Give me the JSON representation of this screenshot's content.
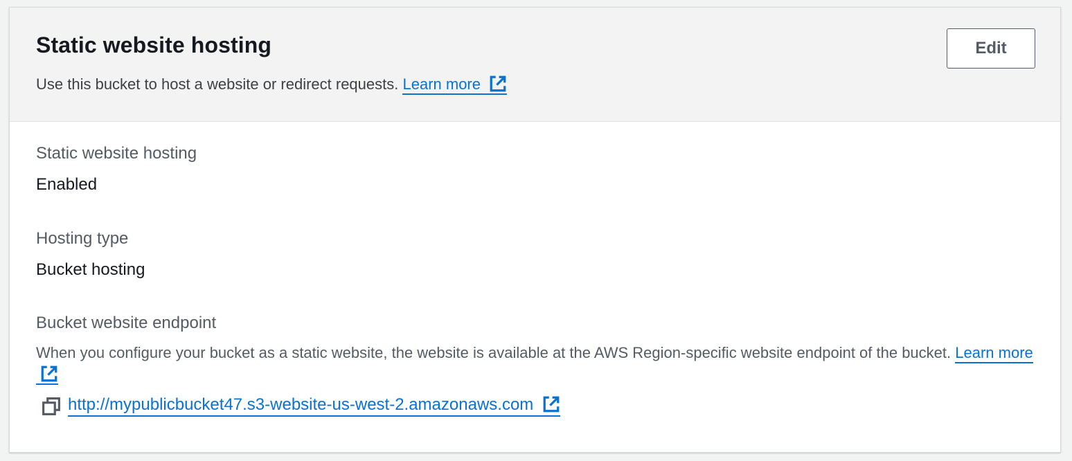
{
  "panel": {
    "title": "Static website hosting",
    "description": "Use this bucket to host a website or redirect requests.",
    "learn_more": "Learn more",
    "edit_label": "Edit"
  },
  "fields": {
    "hosting_label": "Static website hosting",
    "hosting_value": "Enabled",
    "type_label": "Hosting type",
    "type_value": "Bucket hosting",
    "endpoint_label": "Bucket website endpoint",
    "endpoint_desc": "When you configure your bucket as a static website, the website is available at the AWS Region-specific website endpoint of the bucket.",
    "endpoint_learn_more": "Learn more",
    "endpoint_url": "http://mypublicbucket47.s3-website-us-west-2.amazonaws.com"
  },
  "icons": {
    "external_link": "external-link-icon",
    "copy": "copy-icon"
  },
  "colors": {
    "link": "#0972d3",
    "header_bg": "#f3f3f3",
    "button_border": "#545b64"
  }
}
